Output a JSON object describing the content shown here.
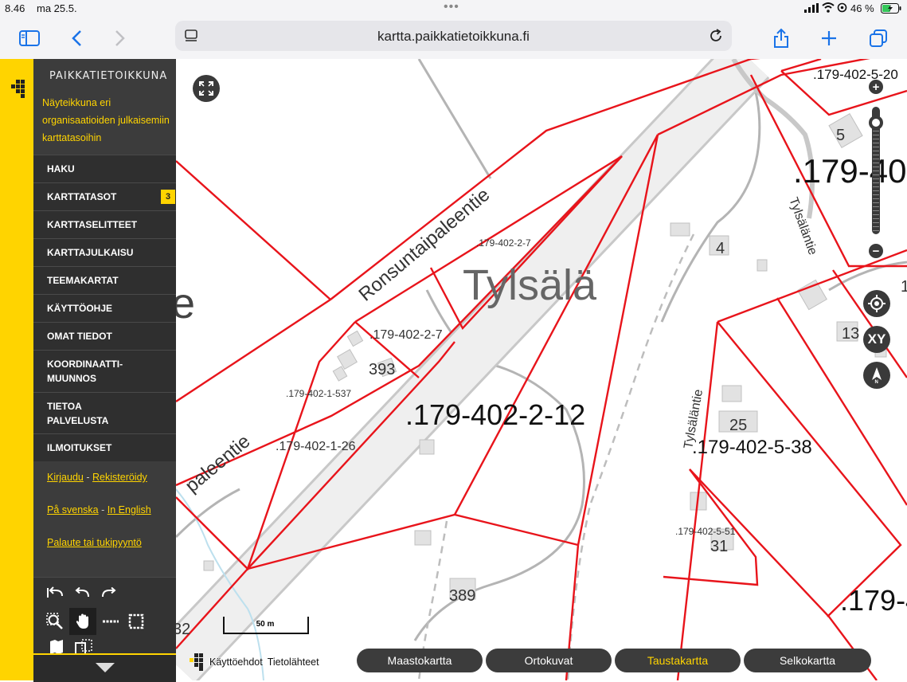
{
  "status_bar": {
    "time": "8.46",
    "date": "ma 25.5.",
    "battery": "46 %"
  },
  "browser": {
    "url": "kartta.paikkatietoikkuna.fi"
  },
  "sidebar": {
    "app_title": "PAIKKATIETOIKKUNA",
    "description": "Näyteikkuna eri organisaatioiden julkaisemiin karttatasoihin",
    "menu": [
      {
        "label": "HAKU"
      },
      {
        "label": "KARTTATASOT",
        "badge": "3"
      },
      {
        "label": "KARTTASELITTEET"
      },
      {
        "label": "KARTTAJULKAISU"
      },
      {
        "label": "TEEMAKARTAT"
      },
      {
        "label": "KÄYTTÖOHJE"
      },
      {
        "label": "OMAT TIEDOT"
      },
      {
        "label": "KOORDINAATTI-\nMUUNNOS"
      },
      {
        "label": "TIETOA\nPALVELUSTA"
      },
      {
        "label": "ILMOITUKSET"
      }
    ],
    "links": {
      "login": "Kirjaudu",
      "register": "Rekisteröidy",
      "swedish": "På svenska",
      "english": "In English",
      "feedback": "Palaute tai tukipyyntö",
      "separator": "-"
    }
  },
  "map": {
    "road_label_main": "Ronsuntaipaleentie",
    "road_label_left": "paleentie",
    "road_label_tylsalantie": "Tylsäläntie",
    "road_label_tylsalantie_top": "Tylsäläntie",
    "place_name": "Tylsälä",
    "fragment_e": "e",
    "parcels": {
      "p1": ".179-402-2-7",
      "p2": ".179-402-2-7",
      "p3": ".179-402-1-537",
      "p4": ".179-402-1-26",
      "p5": ".179-402-2-12",
      "p6": ".179-402-5-38",
      "p7": ".179-402-5-51",
      "p8": ".179-402-5-20",
      "p9": ".179-40",
      "p10": ".179-4"
    },
    "house_numbers": {
      "h393": "393",
      "h389": "389",
      "h4": "4",
      "h5": "5",
      "h13": "13",
      "h25": "25",
      "h31": "31",
      "h32": "32",
      "h1": "1"
    },
    "scale_label": "50 m",
    "xy_label": "XY",
    "footer": {
      "usage": "Käyttöehdot",
      "sources": "Tietolähteet"
    },
    "basemaps": [
      {
        "label": "Maastokartta",
        "active": false
      },
      {
        "label": "Ortokuvat",
        "active": false
      },
      {
        "label": "Taustakartta",
        "active": true
      },
      {
        "label": "Selkokartta",
        "active": false
      }
    ],
    "zoom_level": 0.92
  },
  "colors": {
    "accent_yellow": "#ffd400",
    "parcel_red": "#e8141b",
    "sidebar_dark": "#3c3c3c"
  }
}
